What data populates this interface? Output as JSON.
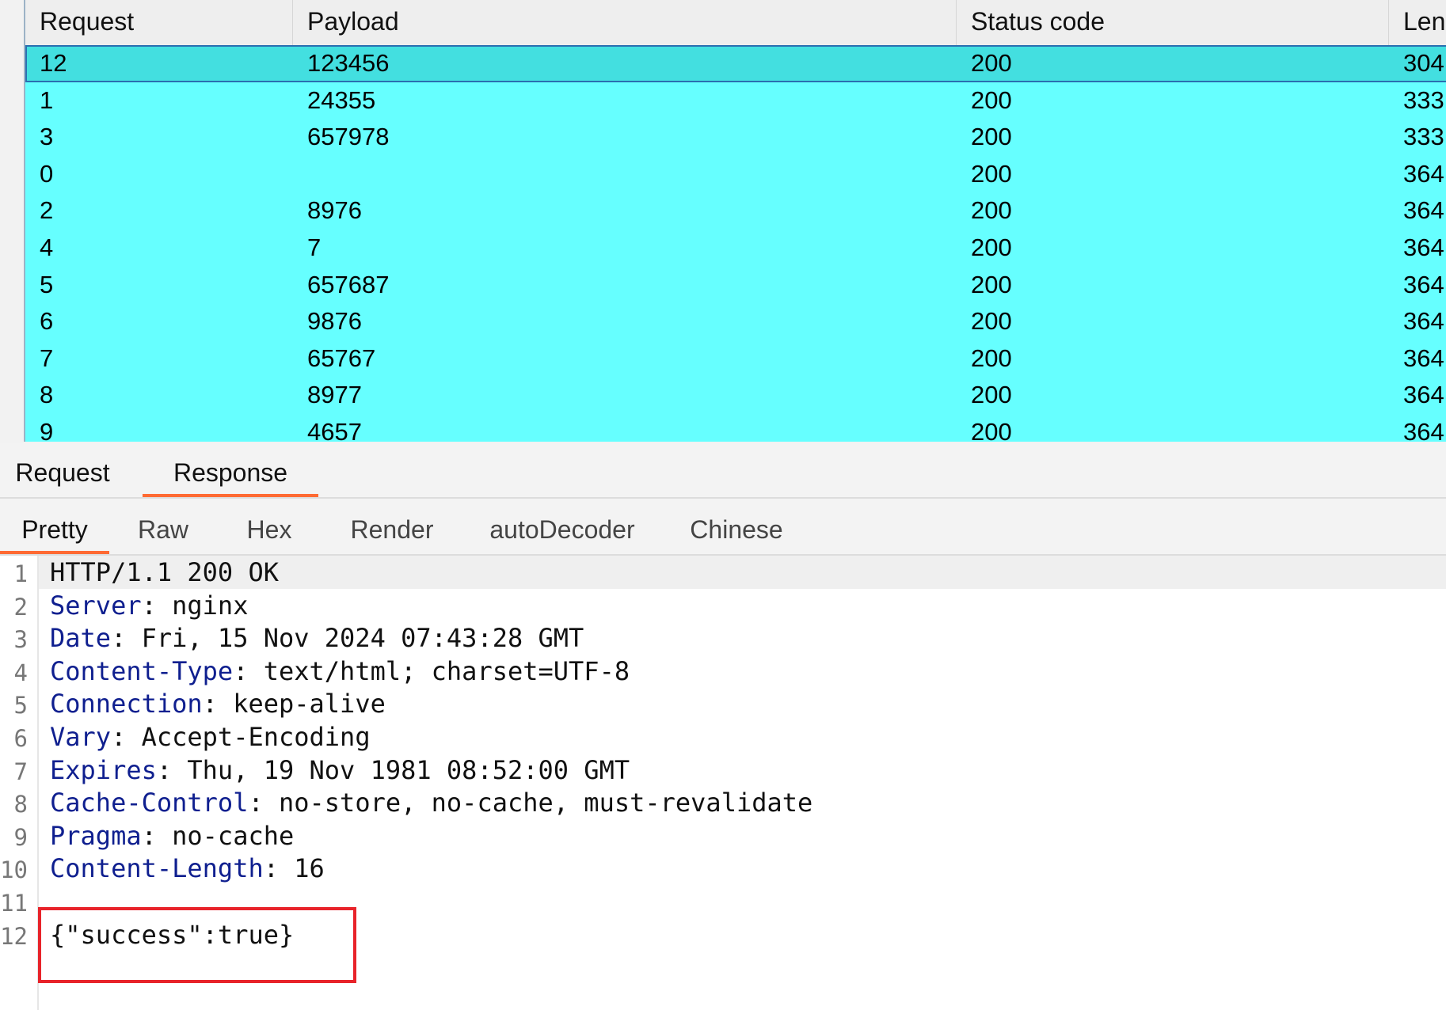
{
  "results_table": {
    "columns": [
      {
        "label": "Request"
      },
      {
        "label": "Payload"
      },
      {
        "label": "Status code"
      },
      {
        "label": "Length",
        "sort_icon": "chevron-up-icon"
      }
    ],
    "rows": [
      {
        "request": "12",
        "payload": "123456",
        "status": "200",
        "length": "304",
        "selected": true
      },
      {
        "request": "1",
        "payload": "24355",
        "status": "200",
        "length": "333"
      },
      {
        "request": "3",
        "payload": "657978",
        "status": "200",
        "length": "333"
      },
      {
        "request": "0",
        "payload": "",
        "status": "200",
        "length": "364"
      },
      {
        "request": "2",
        "payload": "8976",
        "status": "200",
        "length": "364"
      },
      {
        "request": "4",
        "payload": "7",
        "status": "200",
        "length": "364"
      },
      {
        "request": "5",
        "payload": "657687",
        "status": "200",
        "length": "364"
      },
      {
        "request": "6",
        "payload": "9876",
        "status": "200",
        "length": "364"
      },
      {
        "request": "7",
        "payload": "65767",
        "status": "200",
        "length": "364"
      },
      {
        "request": "8",
        "payload": "8977",
        "status": "200",
        "length": "364"
      },
      {
        "request": "9",
        "payload": "4657",
        "status": "200",
        "length": "364"
      }
    ],
    "row_color": "#66ffff",
    "selected_row_color": "#43dfe0"
  },
  "main_tabs": {
    "items": [
      {
        "label": "Request",
        "active": false
      },
      {
        "label": "Response",
        "active": true
      }
    ],
    "active_color": "#ff6a33"
  },
  "sub_tabs": {
    "items": [
      {
        "label": "Pretty",
        "active": true
      },
      {
        "label": "Raw",
        "active": false
      },
      {
        "label": "Hex",
        "active": false
      },
      {
        "label": "Render",
        "active": false
      },
      {
        "label": "autoDecoder",
        "active": false
      },
      {
        "label": "Chinese",
        "active": false
      }
    ]
  },
  "response": {
    "lines": [
      {
        "num": "1",
        "key": "",
        "value": "HTTP/1.1 200 OK"
      },
      {
        "num": "2",
        "key": "Server",
        "value": ": nginx"
      },
      {
        "num": "3",
        "key": "Date",
        "value": ": Fri, 15 Nov 2024 07:43:28 GMT"
      },
      {
        "num": "4",
        "key": "Content-Type",
        "value": ": text/html; charset=UTF-8"
      },
      {
        "num": "5",
        "key": "Connection",
        "value": ": keep-alive"
      },
      {
        "num": "6",
        "key": "Vary",
        "value": ": Accept-Encoding"
      },
      {
        "num": "7",
        "key": "Expires",
        "value": ": Thu, 19 Nov 1981 08:52:00 GMT"
      },
      {
        "num": "8",
        "key": "Cache-Control",
        "value": ": no-store, no-cache, must-revalidate"
      },
      {
        "num": "9",
        "key": "Pragma",
        "value": ": no-cache"
      },
      {
        "num": "10",
        "key": "Content-Length",
        "value": ": 16"
      },
      {
        "num": "11",
        "key": "",
        "value": ""
      },
      {
        "num": "12",
        "key": "",
        "value": "{\"success\":true}"
      }
    ],
    "header_key_color": "#0f1f8f",
    "highlight_box_color": "#e8232a"
  }
}
